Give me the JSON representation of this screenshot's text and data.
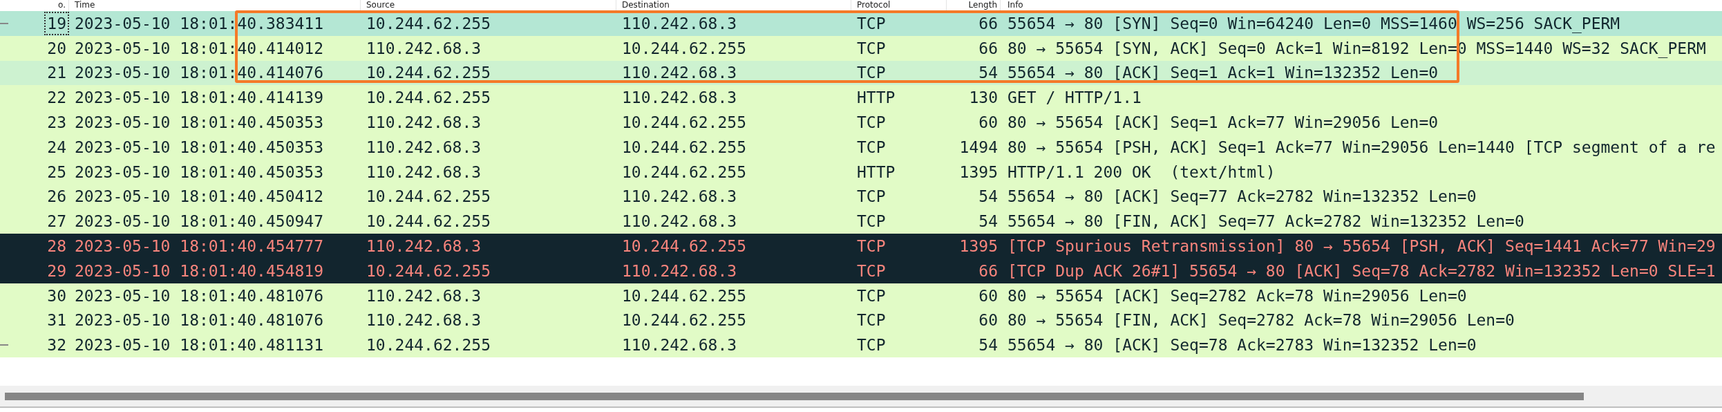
{
  "columns": [
    {
      "label": "o."
    },
    {
      "label": "Time"
    },
    {
      "label": "Source"
    },
    {
      "label": "Destination"
    },
    {
      "label": "Protocol"
    },
    {
      "label": "Length"
    },
    {
      "label": "Info"
    }
  ],
  "rows": [
    {
      "cells": [
        "19",
        "2023-05-10 18:01:40.383411",
        "10.244.62.255",
        "110.242.68.3",
        "TCP",
        "66",
        "55654 → 80 [SYN] Seq=0 Win=64240 Len=0 MSS=1460 WS=256 SACK_PERM"
      ],
      "color": "#b4e7d4",
      "kind": "normal",
      "selected": true,
      "boxed": true,
      "bracket_start": true
    },
    {
      "cells": [
        "20",
        "2023-05-10 18:01:40.414012",
        "110.242.68.3",
        "10.244.62.255",
        "TCP",
        "66",
        "80 → 55654 [SYN, ACK] Seq=0 Ack=1 Win=8192 Len=0 MSS=1440 WS=32 SACK_PERM"
      ],
      "color": "#e1fbc6",
      "kind": "normal",
      "selected": false,
      "boxed": true
    },
    {
      "cells": [
        "21",
        "2023-05-10 18:01:40.414076",
        "10.244.62.255",
        "110.242.68.3",
        "TCP",
        "54",
        "55654 → 80 [ACK] Seq=1 Ack=1 Win=132352 Len=0"
      ],
      "color": "#cdf2d0",
      "kind": "normal",
      "selected": false,
      "boxed": true
    },
    {
      "cells": [
        "22",
        "2023-05-10 18:01:40.414139",
        "10.244.62.255",
        "110.242.68.3",
        "HTTP",
        "130",
        "GET / HTTP/1.1"
      ],
      "color": "#e1fbc6",
      "kind": "normal",
      "selected": false,
      "boxed": false
    },
    {
      "cells": [
        "23",
        "2023-05-10 18:01:40.450353",
        "110.242.68.3",
        "10.244.62.255",
        "TCP",
        "60",
        "80 → 55654 [ACK] Seq=1 Ack=77 Win=29056 Len=0"
      ],
      "color": "#e1fbc6",
      "kind": "normal",
      "selected": false,
      "boxed": false
    },
    {
      "cells": [
        "24",
        "2023-05-10 18:01:40.450353",
        "110.242.68.3",
        "10.244.62.255",
        "TCP",
        "1494",
        "80 → 55654 [PSH, ACK] Seq=1 Ack=77 Win=29056 Len=1440 [TCP segment of a re"
      ],
      "color": "#e1fbc6",
      "kind": "normal",
      "selected": false,
      "boxed": false
    },
    {
      "cells": [
        "25",
        "2023-05-10 18:01:40.450353",
        "110.242.68.3",
        "10.244.62.255",
        "HTTP",
        "1395",
        "HTTP/1.1 200 OK  (text/html)"
      ],
      "color": "#e1fbc6",
      "kind": "normal",
      "selected": false,
      "boxed": false
    },
    {
      "cells": [
        "26",
        "2023-05-10 18:01:40.450412",
        "10.244.62.255",
        "110.242.68.3",
        "TCP",
        "54",
        "55654 → 80 [ACK] Seq=77 Ack=2782 Win=132352 Len=0"
      ],
      "color": "#e1fbc6",
      "kind": "normal",
      "selected": false,
      "boxed": false
    },
    {
      "cells": [
        "27",
        "2023-05-10 18:01:40.450947",
        "10.244.62.255",
        "110.242.68.3",
        "TCP",
        "54",
        "55654 → 80 [FIN, ACK] Seq=77 Ack=2782 Win=132352 Len=0"
      ],
      "color": "#e1fbc6",
      "kind": "normal",
      "selected": false,
      "boxed": false
    },
    {
      "cells": [
        "28",
        "2023-05-10 18:01:40.454777",
        "110.242.68.3",
        "10.244.62.255",
        "TCP",
        "1395",
        "[TCP Spurious Retransmission] 80 → 55654 [PSH, ACK] Seq=1441 Ack=77 Win=29"
      ],
      "color": "#12252e",
      "kind": "error",
      "selected": false,
      "boxed": false
    },
    {
      "cells": [
        "29",
        "2023-05-10 18:01:40.454819",
        "10.244.62.255",
        "110.242.68.3",
        "TCP",
        "66",
        "[TCP Dup ACK 26#1] 55654 → 80 [ACK] Seq=78 Ack=2782 Win=132352 Len=0 SLE=1"
      ],
      "color": "#12252e",
      "kind": "error",
      "selected": false,
      "boxed": false
    },
    {
      "cells": [
        "30",
        "2023-05-10 18:01:40.481076",
        "110.242.68.3",
        "10.244.62.255",
        "TCP",
        "60",
        "80 → 55654 [ACK] Seq=2782 Ack=78 Win=29056 Len=0"
      ],
      "color": "#e1fbc6",
      "kind": "normal",
      "selected": false,
      "boxed": false
    },
    {
      "cells": [
        "31",
        "2023-05-10 18:01:40.481076",
        "110.242.68.3",
        "10.244.62.255",
        "TCP",
        "60",
        "80 → 55654 [FIN, ACK] Seq=2782 Ack=78 Win=29056 Len=0"
      ],
      "color": "#e1fbc6",
      "kind": "normal",
      "selected": false,
      "boxed": false
    },
    {
      "cells": [
        "32",
        "2023-05-10 18:01:40.481131",
        "10.244.62.255",
        "110.242.68.3",
        "TCP",
        "54",
        "55654 → 80 [ACK] Seq=78 Ack=2783 Win=132352 Len=0"
      ],
      "color": "#e1fbc6",
      "kind": "normal",
      "selected": false,
      "boxed": false,
      "bracket_end": true
    }
  ]
}
